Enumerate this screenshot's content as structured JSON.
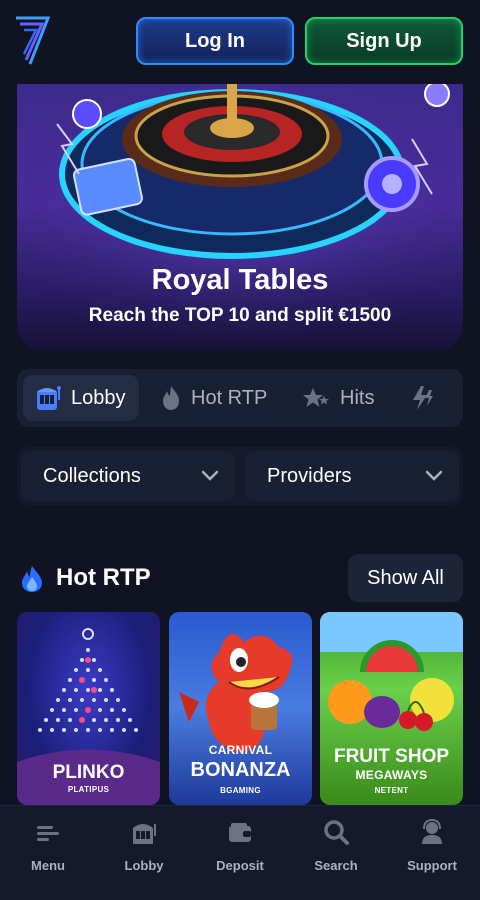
{
  "header": {
    "login_label": "Log In",
    "signup_label": "Sign Up"
  },
  "banner": {
    "title": "Royal Tables",
    "subtitle": "Reach the TOP 10 and split €1500"
  },
  "tabs": [
    {
      "label": "Lobby",
      "icon": "slot-machine-icon",
      "active": true
    },
    {
      "label": "Hot RTP",
      "icon": "fire-icon",
      "active": false
    },
    {
      "label": "Hits",
      "icon": "stars-icon",
      "active": false
    },
    {
      "label": "",
      "icon": "lightning-icon",
      "active": false
    }
  ],
  "filters": {
    "collections_label": "Collections",
    "providers_label": "Providers"
  },
  "section": {
    "title": "Hot RTP",
    "show_all_label": "Show All"
  },
  "games": [
    {
      "name": "PLINKO",
      "provider": "PLATIPUS"
    },
    {
      "name_line1": "CARNIVAL",
      "name_line2": "BONANZA",
      "provider": "BGAMING"
    },
    {
      "name_line1": "FRUIT SHOP",
      "name_line2": "MEGAWAYS",
      "provider": "NETENT"
    }
  ],
  "bottom_nav": [
    {
      "label": "Menu",
      "icon": "menu-icon"
    },
    {
      "label": "Lobby",
      "icon": "slot-machine-icon"
    },
    {
      "label": "Deposit",
      "icon": "wallet-icon"
    },
    {
      "label": "Search",
      "icon": "search-icon"
    },
    {
      "label": "Support",
      "icon": "support-agent-icon"
    }
  ],
  "colors": {
    "background": "#0f1322",
    "login_border": "#2b8cff",
    "signup_border": "#1fd36a",
    "panel": "#1a2033"
  }
}
